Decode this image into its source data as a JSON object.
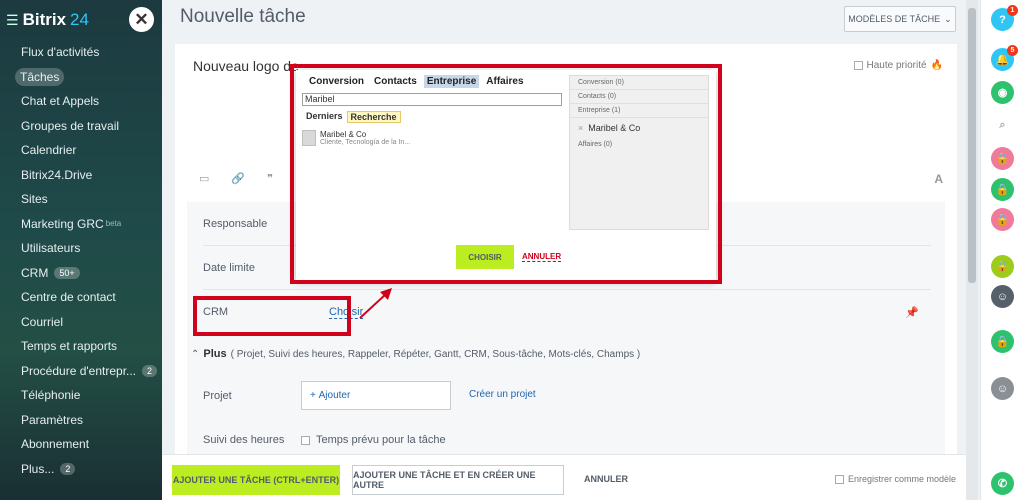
{
  "sidebar": {
    "logo": "Bitrix",
    "logo_num": "24",
    "items": [
      {
        "label": "Flux d'activités"
      },
      {
        "label": "Tâches",
        "active": true
      },
      {
        "label": "Chat et Appels"
      },
      {
        "label": "Groupes de travail"
      },
      {
        "label": "Calendrier"
      },
      {
        "label": "Bitrix24.Drive"
      },
      {
        "label": "Sites"
      },
      {
        "label": "Marketing GRC",
        "sup": "beta"
      },
      {
        "label": "Utilisateurs"
      },
      {
        "label": "CRM",
        "badge": "50+"
      },
      {
        "label": "Centre de contact"
      },
      {
        "label": "Courriel"
      },
      {
        "label": "Temps et rapports"
      },
      {
        "label": "Procédure d'entrepr...",
        "badge": "2"
      },
      {
        "label": "Téléphonie"
      },
      {
        "label": "Paramètres"
      },
      {
        "label": "Abonnement"
      },
      {
        "label": "Plus...",
        "badge": "2"
      }
    ]
  },
  "header": {
    "title": "Nouvelle tâche",
    "templates_btn": "MODÈLES DE TÂCHE"
  },
  "task": {
    "title_visible": "Nouveau logo de",
    "high_priority": "Haute priorité",
    "fields": {
      "responsible": "Responsable",
      "deadline": "Date limite",
      "crm": "CRM",
      "crm_choose": "Choisir"
    },
    "plus_label": "Plus",
    "plus_items": "( Projet,  Suivi des heures,  Rappeler,  Répéter,  Gantt,  CRM,  Sous-tâche,  Mots-clés,  Champs )",
    "project_label": "Projet",
    "add": "Ajouter",
    "create_project": "Créer un projet",
    "time_label": "Suivi des heures",
    "time_option": "Temps prévu pour la tâche"
  },
  "footer": {
    "add_task": "AJOUTER UNE TÂCHE (CTRL+ENTER)",
    "add_and_create": "AJOUTER UNE TÂCHE ET EN CRÉER UNE AUTRE",
    "cancel": "ANNULER",
    "save_template": "Enregistrer comme modèle"
  },
  "popup": {
    "tabs": [
      "Conversion",
      "Contacts",
      "Entreprise",
      "Affaires"
    ],
    "active_tab": "Entreprise",
    "search_value": "Maribel",
    "subtabs": [
      "Derniers",
      "Recherche"
    ],
    "result": {
      "name": "Maribel & Co",
      "sub": "Cliente, Tecnología de la In..."
    },
    "selected_groups": [
      {
        "header": "Conversion (0)"
      },
      {
        "header": "Contacts (0)"
      },
      {
        "header": "Entreprise (1)",
        "item": "Maribel & Co"
      },
      {
        "header": "Affaires (0)"
      }
    ],
    "choose": "CHOISIR",
    "cancel": "ANNULER"
  },
  "rightbar": {
    "help_badge": "1",
    "notif_badge": "5"
  },
  "colors": {
    "accent_green": "#bbed21",
    "link_blue": "#2067b0",
    "highlight_red": "#d0021b",
    "rightbar_green": "#2fc26e",
    "rightbar_pink": "#f07a9a"
  }
}
